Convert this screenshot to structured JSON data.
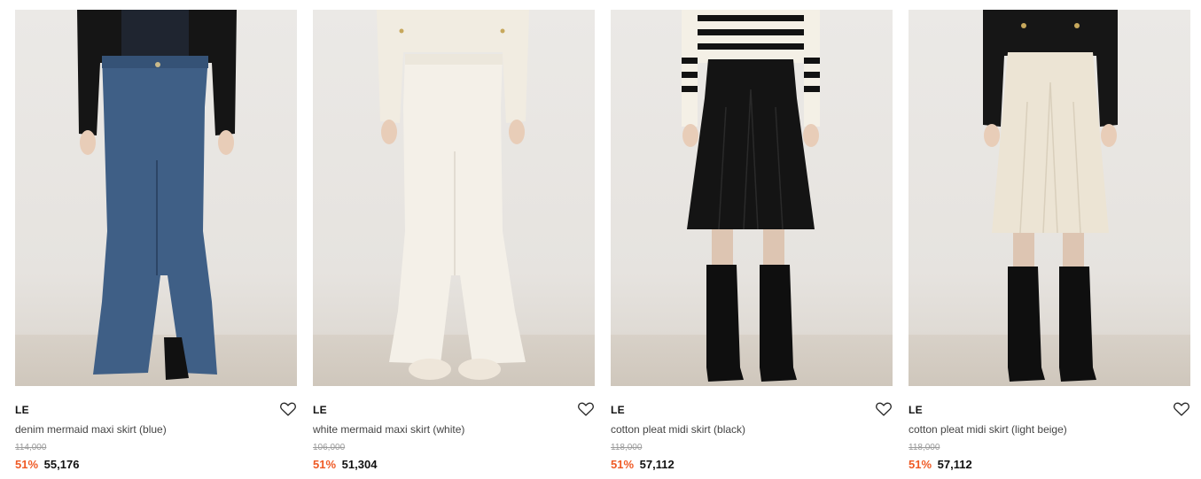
{
  "products": [
    {
      "brand": "LE",
      "name": "denim mermaid maxi skirt (blue)",
      "original_price": "114,000",
      "discount": "51%",
      "price": "55,176",
      "image_name": "denim-skirt-photo",
      "skirt_color": "#3f5f86",
      "top_color": "#1a1a1a"
    },
    {
      "brand": "LE",
      "name": "white mermaid maxi skirt (white)",
      "original_price": "106,000",
      "discount": "51%",
      "price": "51,304",
      "image_name": "white-skirt-photo",
      "skirt_color": "#f1ede4",
      "top_color": "#f3efe6"
    },
    {
      "brand": "LE",
      "name": "cotton pleat midi skirt (black)",
      "original_price": "118,000",
      "discount": "51%",
      "price": "57,112",
      "image_name": "black-pleat-skirt-photo",
      "skirt_color": "#141414",
      "top_color": "#f4f0e6"
    },
    {
      "brand": "LE",
      "name": "cotton pleat midi skirt (light beige)",
      "original_price": "118,000",
      "discount": "51%",
      "price": "57,112",
      "image_name": "beige-pleat-skirt-photo",
      "skirt_color": "#ece4d4",
      "top_color": "#161616"
    }
  ],
  "icons": {
    "wishlist": "heart-outline-icon"
  },
  "colors": {
    "discount": "#ef5a25",
    "strikethrough": "#9a9a9a"
  }
}
